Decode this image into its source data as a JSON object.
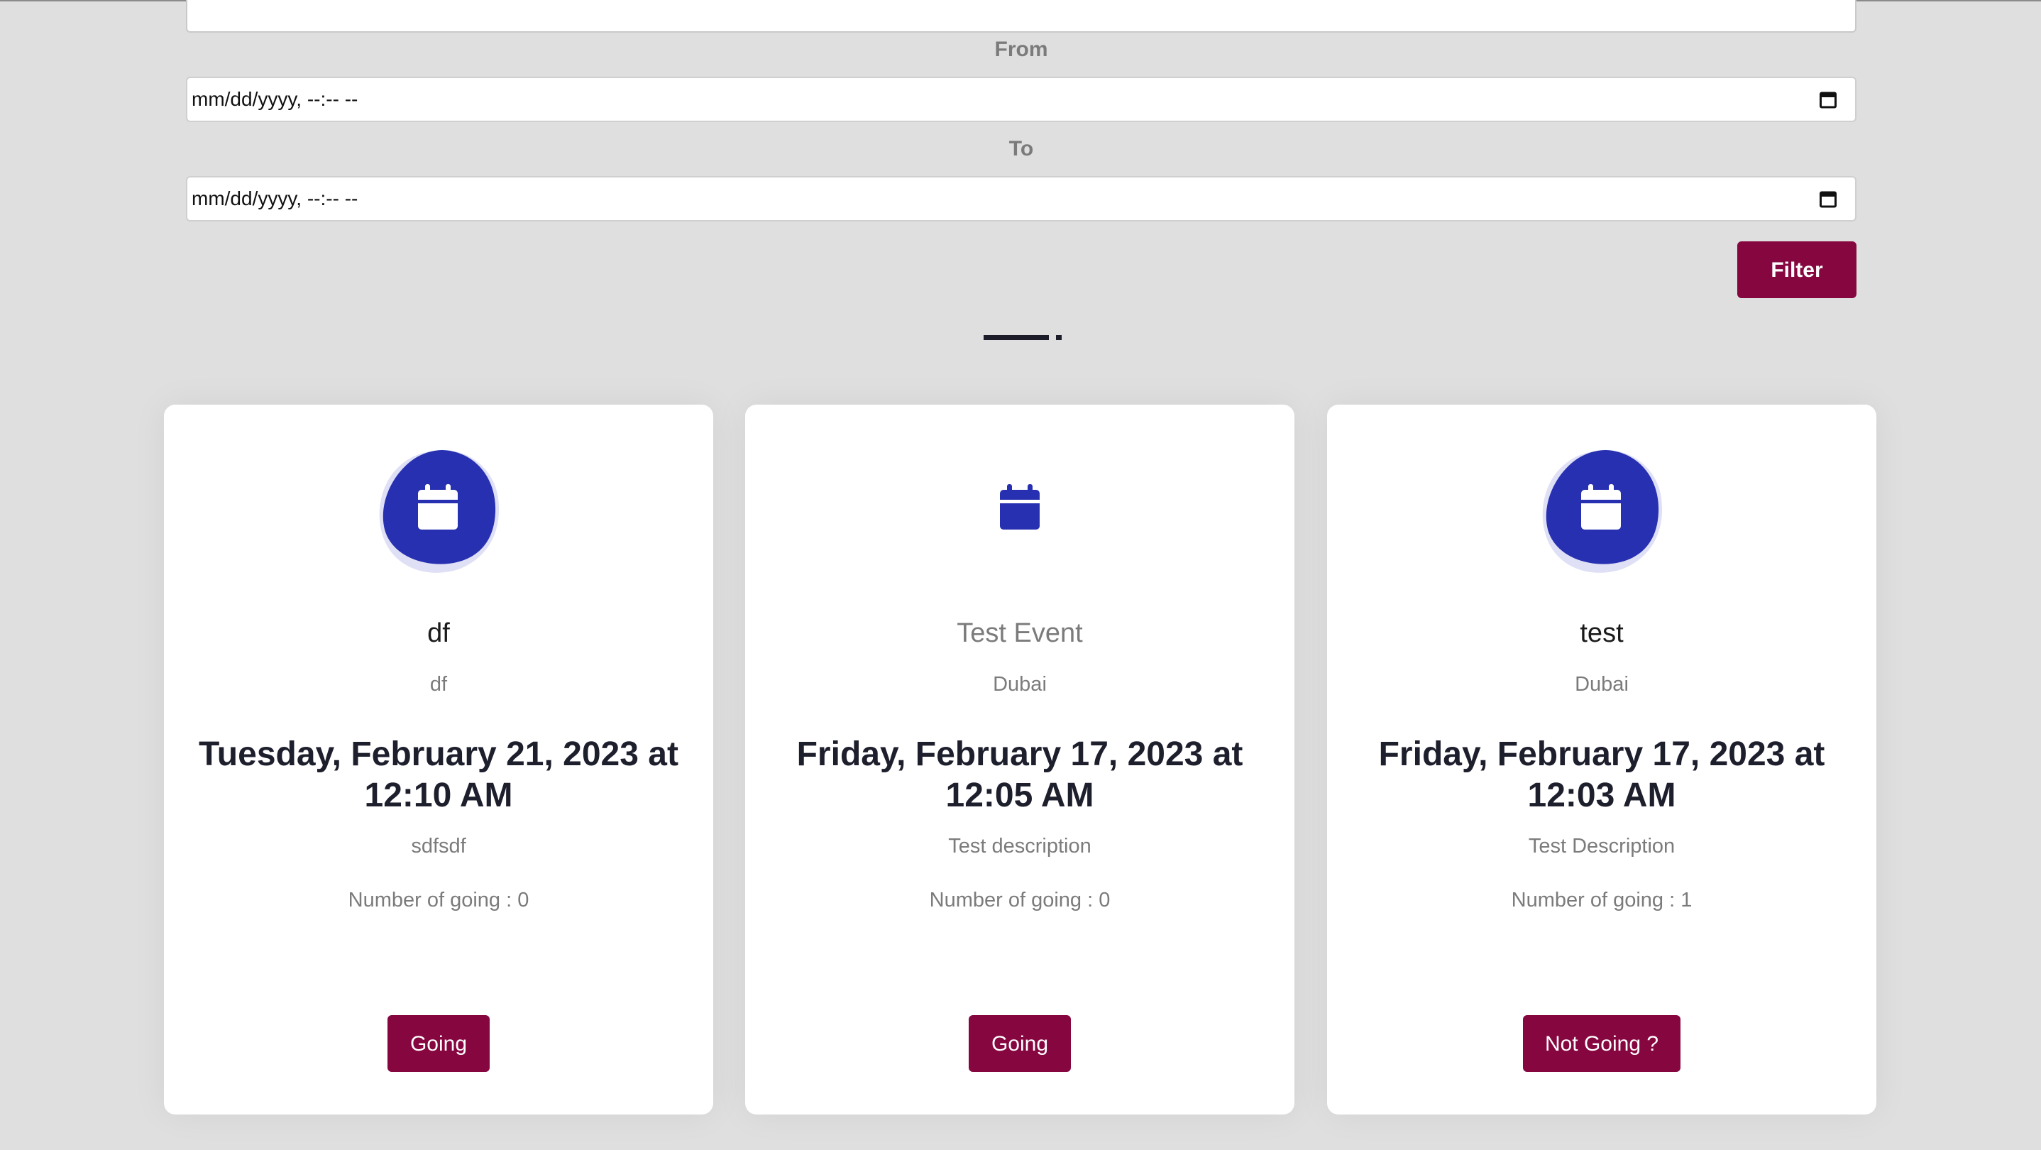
{
  "filters": {
    "from_label": "From",
    "from_value": "mm/dd/yyyy, --:-- --",
    "to_label": "To",
    "to_value": "mm/dd/yyyy, --:-- --",
    "filter_button": "Filter"
  },
  "events": [
    {
      "title": "df",
      "location": "df",
      "date": "Tuesday, February 21, 2023 at 12:10 AM",
      "description": "sdfsdf",
      "going_count": "Number of going : 0",
      "button": "Going",
      "icon": "calendar-icon"
    },
    {
      "title": "Test Event",
      "location": "Dubai",
      "date": "Friday, February 17, 2023 at 12:05 AM",
      "description": "Test description",
      "going_count": "Number of going : 0",
      "button": "Going",
      "icon": "calendar-icon"
    },
    {
      "title": "test",
      "location": "Dubai",
      "date": "Friday, February 17, 2023 at 12:03 AM",
      "description": "Test Description",
      "going_count": "Number of going : 1",
      "button": "Not Going ?",
      "icon": "calendar-icon"
    }
  ],
  "colors": {
    "accent": "#86063f",
    "icon_blue": "#2730b0",
    "icon_blob_light": "#dfe0f5",
    "background": "#dfdfdf"
  }
}
